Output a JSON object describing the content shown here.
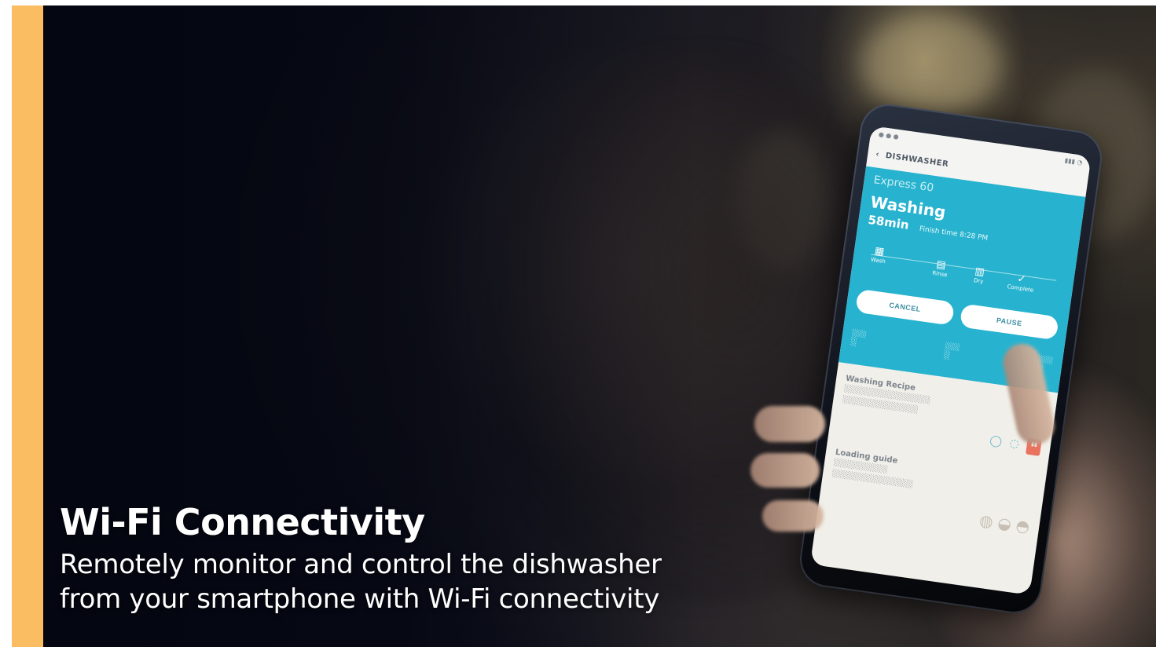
{
  "caption": {
    "title": "Wi-Fi Connectivity",
    "line1": "Remotely monitor and control the dishwasher",
    "line2": "from your smartphone with Wi-Fi connectivity"
  },
  "phone": {
    "app_title": "DISHWASHER",
    "course": "Express 60",
    "status": "Washing",
    "remaining": "58min",
    "finish_time": "Finish time 8:28 PM",
    "steps": [
      "Wash",
      "Rinse",
      "Dry",
      "Complete"
    ],
    "cancel_label": "CANCEL",
    "pause_label": "PAUSE",
    "card_washing_title": "Washing Recipe",
    "card_loading_title": "Loading guide"
  },
  "colors": {
    "accent_bar": "#fbbd62",
    "app_teal": "#27b3cf"
  }
}
